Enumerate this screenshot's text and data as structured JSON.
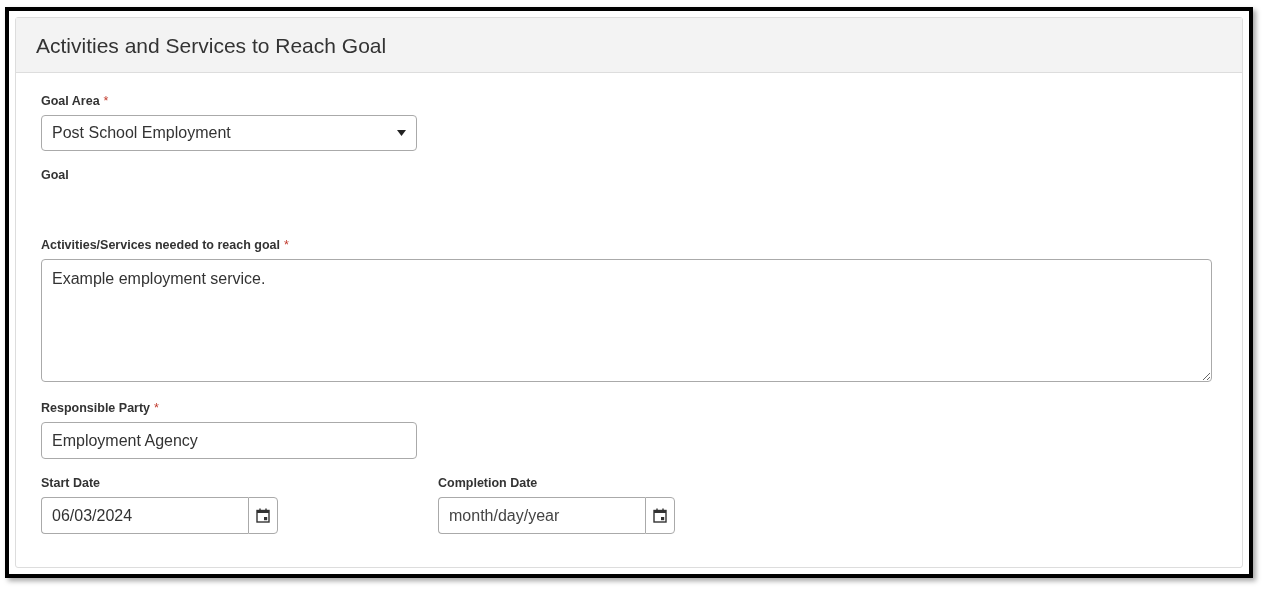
{
  "panel": {
    "title": "Activities and Services to Reach Goal"
  },
  "fields": [
    {
      "kind": "select",
      "label": "Goal Area",
      "marker": "*",
      "value": "Post School Employment"
    },
    {
      "kind": "label",
      "label": "Goal"
    },
    {
      "kind": "textarea",
      "label": "Activities/Services needed to reach goal",
      "marker": "*",
      "value": "Example employment service."
    },
    {
      "kind": "text",
      "label": "Responsible Party",
      "marker": "*",
      "value": "Employment Agency"
    }
  ],
  "dates": [
    {
      "label": "Start Date",
      "value": "06/03/2024"
    },
    {
      "label": "Completion Date",
      "placeholder": "month/day/year"
    }
  ]
}
